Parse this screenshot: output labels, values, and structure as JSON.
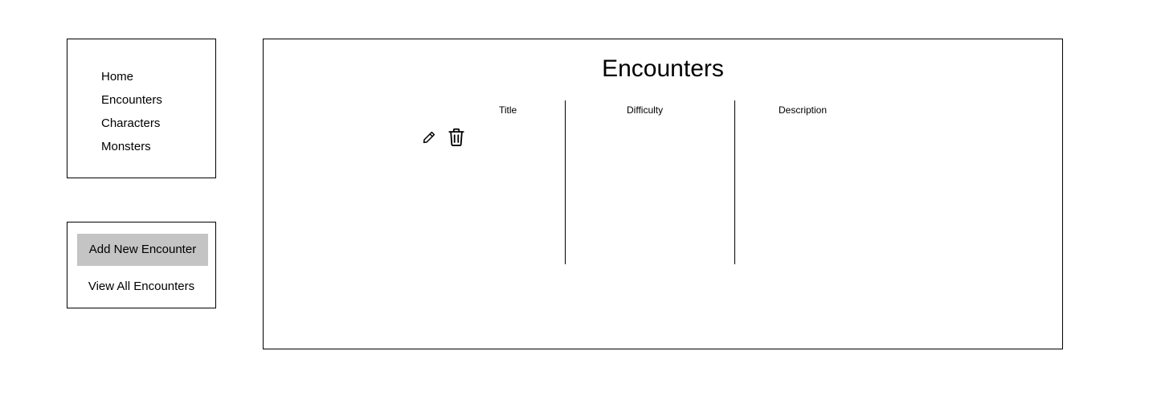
{
  "nav": {
    "items": [
      {
        "label": "Home"
      },
      {
        "label": "Encounters"
      },
      {
        "label": "Characters"
      },
      {
        "label": "Monsters"
      }
    ]
  },
  "actions": {
    "add_label": "Add New Encounter",
    "view_all_label": "View All Encounters"
  },
  "main": {
    "title": "Encounters",
    "columns": [
      {
        "label": "Title"
      },
      {
        "label": "Difficulty"
      },
      {
        "label": "Description"
      }
    ],
    "row_icons": [
      "pencil-icon",
      "trash-icon"
    ]
  },
  "colors": {
    "border": "#000000",
    "button_bg": "#c4c4c4",
    "background": "#ffffff"
  }
}
